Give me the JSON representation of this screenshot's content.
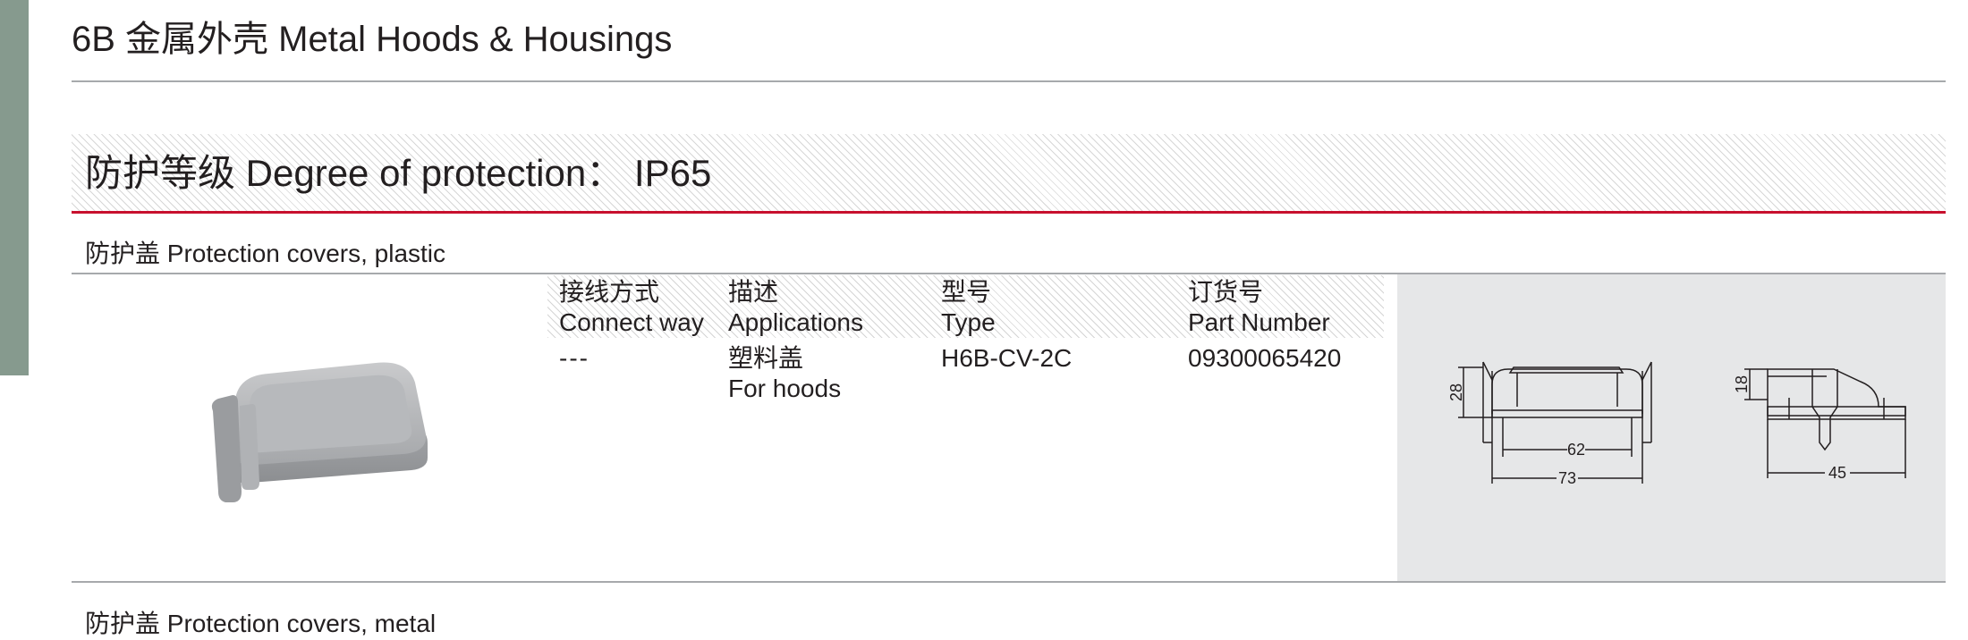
{
  "page": {
    "title": "6B 金属外壳 Metal Hoods & Housings"
  },
  "section": {
    "title": "防护等级 Degree of protection： IP65"
  },
  "groups": [
    {
      "title": "防护盖 Protection covers, plastic",
      "columns": {
        "connect_cn": "接线方式",
        "connect_en": "Connect way",
        "applications_cn": "描述",
        "applications_en": "Applications",
        "type_cn": "型号",
        "type_en": "Type",
        "part_cn": "订货号",
        "part_en": "Part Number"
      },
      "row": {
        "connect": "---",
        "application_cn": "塑料盖",
        "application_en": "For hoods",
        "type": "H6B-CV-2C",
        "part_number": "09300065420"
      },
      "drawing": {
        "front_height": "28",
        "front_inner_width": "62",
        "front_width": "73",
        "side_height": "18",
        "side_width": "45"
      }
    },
    {
      "title": "防护盖 Protection covers, metal"
    }
  ],
  "colors": {
    "side_tab": "#869a8e",
    "section_rule": "#c8102e",
    "drawing_panel": "#e6e7e8"
  }
}
